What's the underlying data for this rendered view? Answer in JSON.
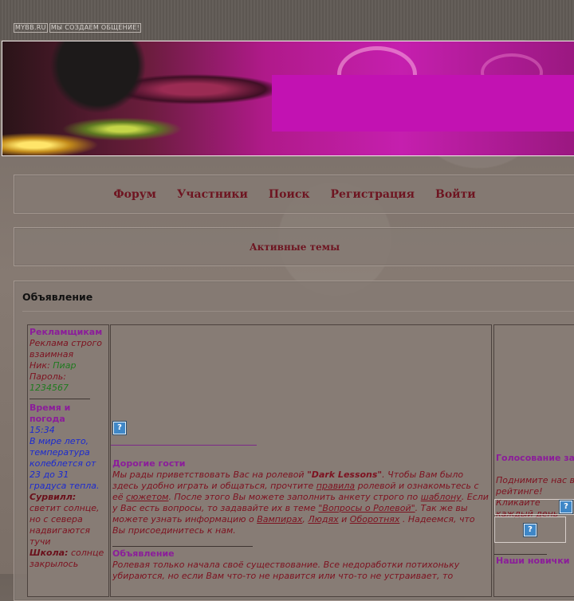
{
  "topbar": {
    "link1": "MYBB.RU",
    "link2": "МЫ СОЗДАЕМ ОБЩЕНИЕ!"
  },
  "nav": [
    "Форум",
    "Участники",
    "Поиск",
    "Регистрация",
    "Войти"
  ],
  "active_topics": "Активные темы",
  "announcement": {
    "title": "Объявление",
    "left": {
      "ads_title": "Рекламщикам",
      "ads_text": "Реклама строго взаимная",
      "nick_label": "Ник:",
      "nick_value": "Пиар",
      "pass_label": "Пароль:",
      "pass_value": "1234567",
      "time_title": "Время и погода",
      "time_value": "15:34",
      "weather": "В мире лето, температура колеблется от 23 до 31 градуса тепла.",
      "survill_label": "Сурвилл:",
      "survill_text": "светит солнце, но с севера надвигаются тучи",
      "school_label": "Школа:",
      "school_text": "солнце закрылось"
    },
    "middle": {
      "guests_title": "Дорогие гости",
      "guests_p1": "Мы рады приветствовать Вас на ролевой ",
      "game_name": "\"Dark Lessons\"",
      "guests_p2": ". Чтобы Вам было здесь удобно играть и общаться, прочтите ",
      "link_rules": "правила",
      "guests_p3": " ролевой и ознакомьтесь с её ",
      "link_plot": "сюжетом",
      "guests_p4": ". После этого Вы можете заполнить анкету строго по ",
      "link_template": "шаблону",
      "guests_p5": ". Если у Вас есть вопросы, то задавайте их в теме ",
      "link_questions": "\"Вопросы о Ролевой\"",
      "guests_p6": ". Так же вы можете узнать информацию о ",
      "link_vampires": "Вампирах",
      "comma": ", ",
      "link_humans": "Людях",
      "and": " и ",
      "link_werewolves": "Оборотнях",
      "guests_p7": " . Надеемся, что Вы присоединитесь к нам.",
      "announce_title": "Объявление",
      "announce_text": "Ролевая только начала своё существование. Все недоработки потихоньку убираются, но если Вам что-то не нравится или что-то не устраивает, то"
    },
    "right": {
      "vote_title": "Голосование за",
      "vote_text": "Поднимите нас в рейтинге! Кликайте каждый день",
      "newbies_title": "Наши новички"
    }
  },
  "icons": {
    "broken_image": "question-mark-icon"
  }
}
